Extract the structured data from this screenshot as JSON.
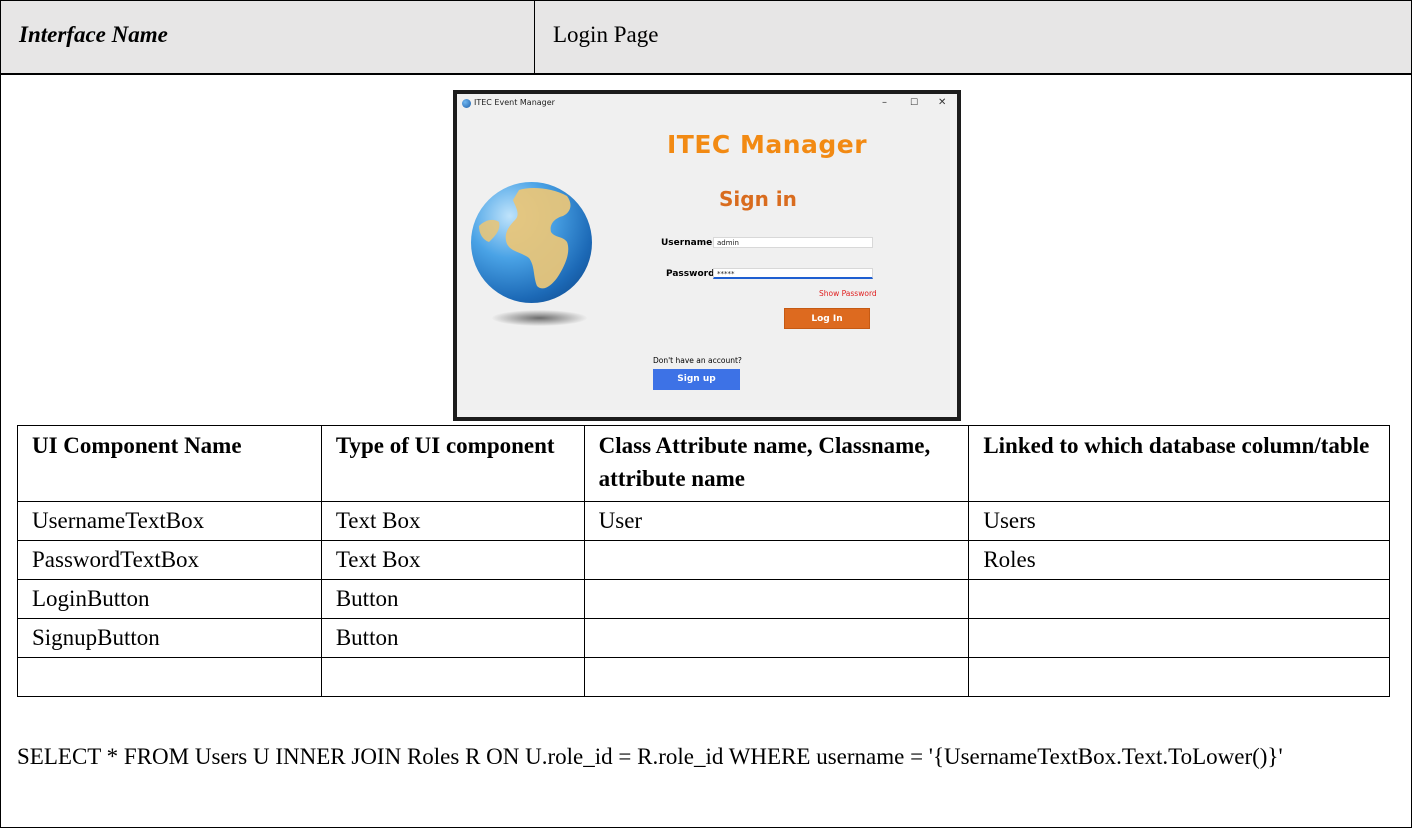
{
  "header": {
    "label": "Interface Name",
    "value": "Login Page"
  },
  "screenshot": {
    "window_title": "ITEC Event Manager",
    "controls": {
      "minimize": "–",
      "maximize": "☐",
      "close": "✕"
    },
    "app_title": "ITEC Manager",
    "heading": "Sign in",
    "username_label": "Username:",
    "username_value": "admin",
    "password_label": "Password:",
    "password_value": "*****",
    "show_password": "Show Password",
    "login_label": "Log In",
    "no_account": "Don't have an account?",
    "signup_label": "Sign up"
  },
  "table": {
    "headers": [
      "UI Component Name",
      "Type of UI component",
      "Class Attribute name, Classname, attribute name",
      "Linked to which database column/table"
    ],
    "rows": [
      [
        "UsernameTextBox",
        "Text Box",
        "User",
        "Users"
      ],
      [
        "PasswordTextBox",
        "Text Box",
        "",
        "Roles"
      ],
      [
        "LoginButton",
        "Button",
        "",
        ""
      ],
      [
        "SignupButton",
        "Button",
        "",
        ""
      ],
      [
        "",
        "",
        "",
        ""
      ]
    ]
  },
  "sql": "SELECT * FROM Users U INNER JOIN Roles R ON U.role_id = R.role_id WHERE username = '{UsernameTextBox.Text.ToLower()}'",
  "colors": {
    "header_bg": "#e7e6e6",
    "app_title": "#f28a13",
    "login_button": "#dd6a1f",
    "signup_button": "#3d72e6",
    "show_password": "#e02020"
  }
}
